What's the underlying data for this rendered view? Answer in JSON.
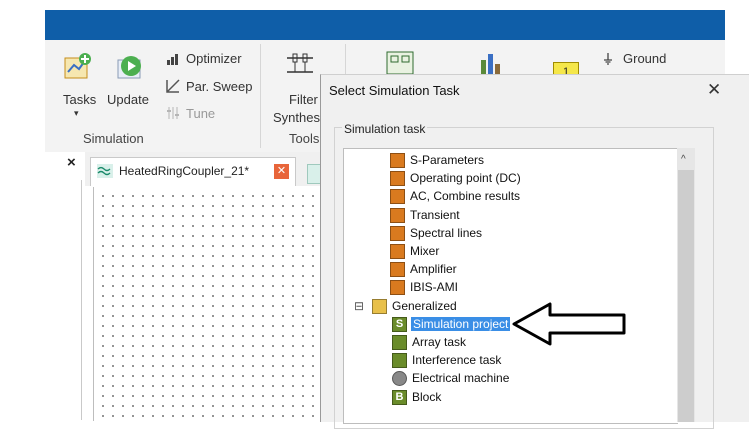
{
  "ribbon": {
    "tasks_label": "Tasks",
    "update_label": "Update",
    "optimizer_label": "Optimizer",
    "par_sweep_label": "Par. Sweep",
    "tune_label": "Tune",
    "simulation_group": "Simulation",
    "filter_label": "Filter",
    "synthesis_label": "Synthes",
    "tools_group": "Tools",
    "ground_label": "Ground",
    "badge_value": "1"
  },
  "left_panel": {
    "close_glyph": "×"
  },
  "document_tab": {
    "title": "HeatedRingCoupler_21*"
  },
  "dialog": {
    "title": "Select Simulation Task",
    "close_glyph": "✕",
    "group_label": "Simulation task",
    "tree": [
      {
        "label": "S-Parameters",
        "icon": "s-parameters-icon",
        "color": "#d97a1f"
      },
      {
        "label": "Operating point (DC)",
        "icon": "operating-point-icon",
        "color": "#d97a1f"
      },
      {
        "label": "AC, Combine results",
        "icon": "ac-icon",
        "color": "#d97a1f"
      },
      {
        "label": "Transient",
        "icon": "transient-icon",
        "color": "#d97a1f"
      },
      {
        "label": "Spectral lines",
        "icon": "spectral-lines-icon",
        "color": "#d97a1f"
      },
      {
        "label": "Mixer",
        "icon": "mixer-icon",
        "color": "#d97a1f"
      },
      {
        "label": "Amplifier",
        "icon": "amplifier-icon",
        "color": "#d97a1f"
      },
      {
        "label": "IBIS-AMI",
        "icon": "ibis-ami-icon",
        "color": "#d97a1f"
      },
      {
        "label": "Generalized",
        "icon": "folder-icon",
        "color": "#e8c04a",
        "expander": "⊟"
      },
      {
        "label": "Simulation project",
        "icon": "simulation-project-icon",
        "color": "#6a8c2a",
        "selected": true
      },
      {
        "label": "Array task",
        "icon": "array-task-icon",
        "color": "#6a8c2a"
      },
      {
        "label": "Interference task",
        "icon": "interference-task-icon",
        "color": "#6a8c2a"
      },
      {
        "label": "Electrical machine",
        "icon": "electrical-machine-icon",
        "color": "#888888"
      },
      {
        "label": "Block",
        "icon": "block-icon",
        "color": "#6a8c2a"
      }
    ],
    "scroll_up_glyph": "^"
  },
  "colors": {
    "title_bar": "#0f5ea8",
    "selection": "#3a8ee6"
  }
}
